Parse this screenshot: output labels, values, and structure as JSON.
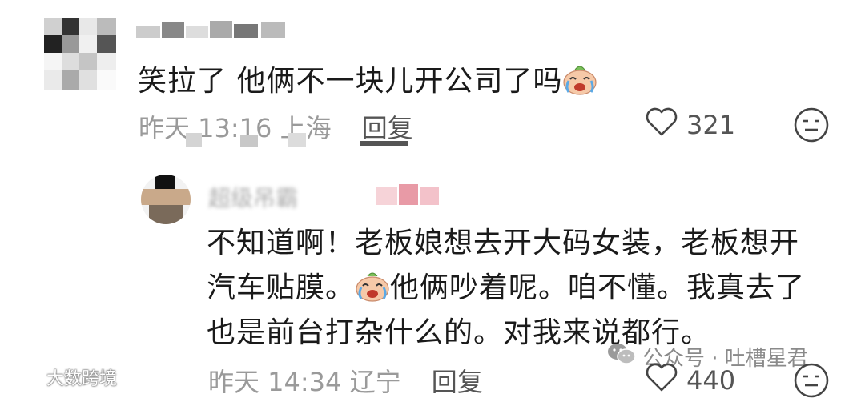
{
  "comment1": {
    "text": "笑拉了 他俩不一块儿开公司了吗",
    "time": "昨天 13:16",
    "location": "上海",
    "reply_label": "回复",
    "like_count": "321",
    "emoji_icon": "laughing-crying-emoji-icon"
  },
  "comment2": {
    "lines": [
      "不知道啊！老板娘想去开大码女装，老板想开",
      "汽车贴膜。",
      "他俩吵着呢。咱不懂。我真去了",
      "也是前台打杂什么的。对我来说都行。"
    ],
    "username_blurred": "超级吊霸",
    "time": "昨天 14:34",
    "location": "辽宁",
    "reply_label": "回复",
    "like_count": "440",
    "emoji_icon": "laughing-crying-emoji-icon"
  },
  "watermark": {
    "text": "公众号 · 吐槽星君",
    "left_text": "大数跨境"
  },
  "colors": {
    "meta": "#9a9a9a",
    "text": "#1a1a1a",
    "icon": "#555555"
  }
}
